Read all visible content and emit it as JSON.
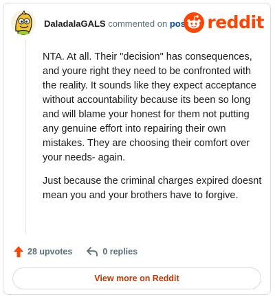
{
  "comment": {
    "username": "DaladalaGALS",
    "action_text": "commented on",
    "post_link_label": "post",
    "paragraphs": [
      "NTA. At all. Their \"decision\" has consequences, and youre right they need to be confronted with the reality. It sounds like they expect acceptance without accountability because its been so long and will blame your honest for them not putting any genuine effort into repairing their own mistakes. They are choosing their comfort over your needs- again.",
      "Just because the criminal charges expired doesnt mean you and your brothers have to forgive."
    ]
  },
  "brand": {
    "wordmark": "reddit",
    "color": "#ff4500"
  },
  "stats": {
    "upvotes_label": "28 upvotes",
    "replies_label": "0 replies"
  },
  "footer": {
    "view_more_label": "View more on Reddit"
  },
  "icons": {
    "avatar": "snoo-avatar-icon",
    "logo": "reddit-snoo-icon",
    "upvote": "upvote-arrow-icon",
    "reply": "reply-arrow-icon"
  }
}
